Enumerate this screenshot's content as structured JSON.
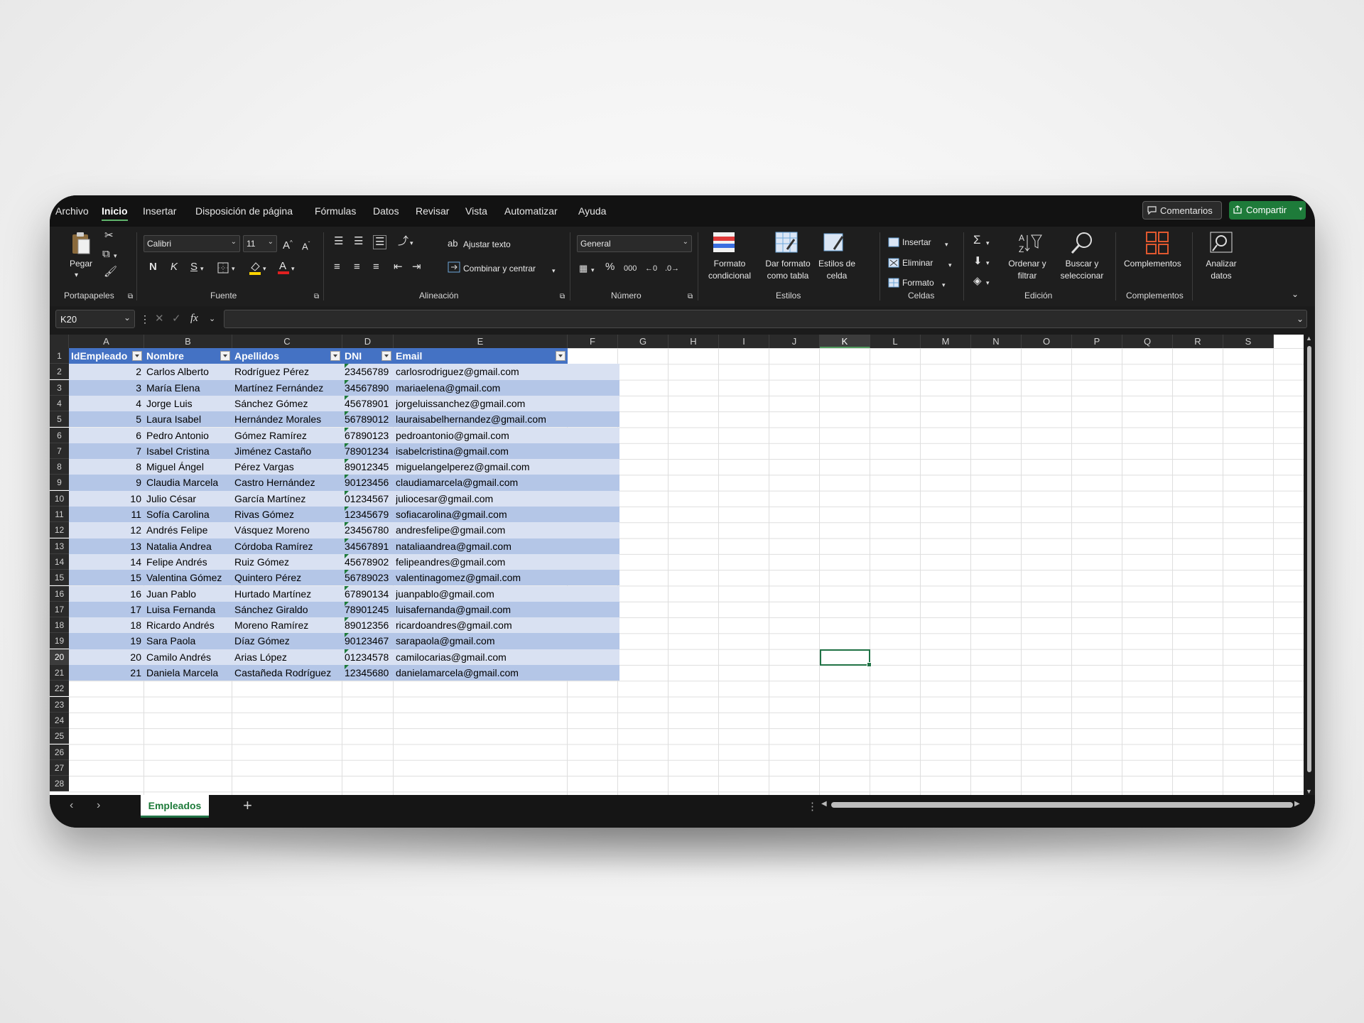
{
  "menu": {
    "tabs": [
      "Archivo",
      "Inicio",
      "Insertar",
      "Disposición de página",
      "Fórmulas",
      "Datos",
      "Revisar",
      "Vista",
      "Automatizar",
      "Ayuda"
    ],
    "comments_label": "Comentarios",
    "share_label": "Compartir"
  },
  "ribbon": {
    "clipboard": {
      "paste_label": "Pegar",
      "group_label": "Portapapeles"
    },
    "font": {
      "font_name": "Calibri",
      "font_size": "11",
      "bold": "N",
      "italic": "K",
      "underline": "S",
      "group_label": "Fuente"
    },
    "alignment": {
      "wrap_label": "Ajustar texto",
      "merge_label": "Combinar y centrar",
      "group_label": "Alineación"
    },
    "number": {
      "format": "General",
      "group_label": "Número"
    },
    "styles": {
      "conditional_l1": "Formato",
      "conditional_l2": "condicional",
      "table_l1": "Dar formato",
      "table_l2": "como tabla",
      "cell_l1": "Estilos de",
      "cell_l2": "celda",
      "group_label": "Estilos"
    },
    "cells": {
      "insert": "Insertar",
      "delete": "Eliminar",
      "format": "Formato",
      "group_label": "Celdas"
    },
    "editing": {
      "sort_l1": "Ordenar y",
      "sort_l2": "filtrar",
      "find_l1": "Buscar y",
      "find_l2": "seleccionar",
      "group_label": "Edición"
    },
    "addins": {
      "label": "Complementos",
      "group_label": "Complementos"
    },
    "analyze": {
      "l1": "Analizar",
      "l2": "datos"
    }
  },
  "formula_bar": {
    "name_box": "K20",
    "formula": ""
  },
  "columns": [
    "A",
    "B",
    "C",
    "D",
    "E",
    "F",
    "G",
    "H",
    "I",
    "J",
    "K",
    "L",
    "M",
    "N",
    "O",
    "P",
    "Q",
    "R",
    "S"
  ],
  "selected_column": "K",
  "selected_row": 20,
  "row_numbers": [
    1,
    2,
    3,
    4,
    5,
    6,
    7,
    8,
    9,
    10,
    11,
    12,
    13,
    14,
    15,
    16,
    17,
    18,
    19,
    20,
    21,
    22,
    23,
    24,
    25,
    26,
    27,
    28
  ],
  "table": {
    "headers": [
      "IdEmpleado",
      "Nombre",
      "Apellidos",
      "DNI",
      "Email"
    ],
    "rows": [
      [
        "2",
        "Carlos Alberto",
        "Rodríguez Pérez",
        "23456789",
        "carlosrodriguez@gmail.com"
      ],
      [
        "3",
        "María Elena",
        "Martínez Fernández",
        "34567890",
        "mariaelena@gmail.com"
      ],
      [
        "4",
        "Jorge Luis",
        "Sánchez Gómez",
        "45678901",
        "jorgeluissanchez@gmail.com"
      ],
      [
        "5",
        "Laura Isabel",
        "Hernández Morales",
        "56789012",
        "lauraisabelhernandez@gmail.com"
      ],
      [
        "6",
        "Pedro Antonio",
        "Gómez Ramírez",
        "67890123",
        "pedroantonio@gmail.com"
      ],
      [
        "7",
        "Isabel Cristina",
        "Jiménez Castaño",
        "78901234",
        "isabelcristina@gmail.com"
      ],
      [
        "8",
        "Miguel Ángel",
        "Pérez Vargas",
        "89012345",
        "miguelangelperez@gmail.com"
      ],
      [
        "9",
        "Claudia Marcela",
        "Castro Hernández",
        "90123456",
        "claudiamarcela@gmail.com"
      ],
      [
        "10",
        "Julio César",
        "García Martínez",
        "01234567",
        "juliocesar@gmail.com"
      ],
      [
        "11",
        "Sofía Carolina",
        "Rivas Gómez",
        "12345679",
        "sofiacarolina@gmail.com"
      ],
      [
        "12",
        "Andrés Felipe",
        "Vásquez Moreno",
        "23456780",
        "andresfelipe@gmail.com"
      ],
      [
        "13",
        "Natalia Andrea",
        "Córdoba Ramírez",
        "34567891",
        "nataliaandrea@gmail.com"
      ],
      [
        "14",
        "Felipe Andrés",
        "Ruiz Gómez",
        "45678902",
        "felipeandres@gmail.com"
      ],
      [
        "15",
        "Valentina Gómez",
        "Quintero Pérez",
        "56789023",
        "valentinagomez@gmail.com"
      ],
      [
        "16",
        "Juan Pablo",
        "Hurtado Martínez",
        "67890134",
        "juanpablo@gmail.com"
      ],
      [
        "17",
        "Luisa Fernanda",
        "Sánchez Giraldo",
        "78901245",
        "luisafernanda@gmail.com"
      ],
      [
        "18",
        "Ricardo Andrés",
        "Moreno Ramírez",
        "89012356",
        "ricardoandres@gmail.com"
      ],
      [
        "19",
        "Sara Paola",
        "Díaz Gómez",
        "90123467",
        "sarapaola@gmail.com"
      ],
      [
        "20",
        "Camilo Andrés",
        "Arias López",
        "01234578",
        "camilocarias@gmail.com"
      ],
      [
        "21",
        "Daniela Marcela",
        "Castañeda Rodríguez",
        "12345680",
        "danielamarcela@gmail.com"
      ]
    ]
  },
  "sheet_tabs": [
    "Empleados"
  ],
  "colors": {
    "accent": "#217346",
    "table_header": "#4472c4",
    "band_light": "#d9e1f2",
    "band_dark": "#b4c6e7",
    "share": "#1e7b3a"
  }
}
